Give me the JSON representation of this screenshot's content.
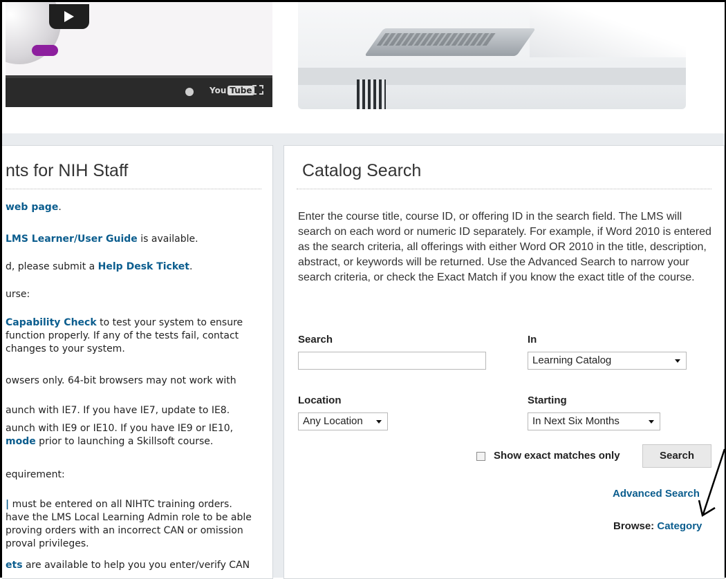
{
  "video": {
    "youtube_label": "YouTube",
    "icons": [
      "play-icon",
      "clock-icon",
      "fullscreen-icon"
    ]
  },
  "left_panel": {
    "title": "nts for NIH Staff",
    "p1": {
      "link": "web page",
      "tail": "."
    },
    "p2": {
      "link": "LMS Learner/User Guide",
      "tail": " is available."
    },
    "p3": {
      "head": "d, please submit a ",
      "link": "Help Desk Ticket",
      "tail": "."
    },
    "h1": "urse:",
    "p4": {
      "link": "Capability Check",
      "tail": " to test your system to ensure",
      "line2": "function properly. If any of the tests fail, contact",
      "line3": "changes to your system."
    },
    "p5": "owsers only. 64-bit browsers may not work with",
    "p6": "aunch with IE7. If you have IE7, update to IE8.",
    "p7": {
      "line1": "aunch with IE9 or IE10. If you have IE9 or IE10,",
      "link": "mode",
      "tail": " prior to launching a Skillsoft course."
    },
    "h2": "equirement:",
    "p8": {
      "line1": "must be entered on all NIHTC training orders.",
      "line2": "have the LMS Local Learning Admin role to be able",
      "line3": "proving orders with an incorrect CAN or omission",
      "line4": "proval privileges."
    },
    "p9": {
      "link": "ets",
      "tail": " are available to help you you enter/verify CAN"
    }
  },
  "catalog": {
    "title": "Catalog Search",
    "intro": "Enter the course title, course ID, or offering ID in the search field. The LMS will search on each word or numeric ID separately. For example, if Word 2010 is entered as the search criteria, all offerings with either Word OR 2010 in the title, description, abstract, or keywords will be returned. Use the Advanced Search to narrow your search criteria, or check the Exact Match if you know the exact title of the course.",
    "search_label": "Search",
    "search_value": "",
    "in_label": "In",
    "in_value": "Learning Catalog",
    "location_label": "Location",
    "location_value": "Any Location",
    "starting_label": "Starting",
    "starting_value": "In Next Six Months",
    "exact_label": "Show exact matches only",
    "search_button": "Search",
    "advanced_link": "Advanced Search",
    "browse_label": "Browse: ",
    "browse_link": "Category"
  }
}
